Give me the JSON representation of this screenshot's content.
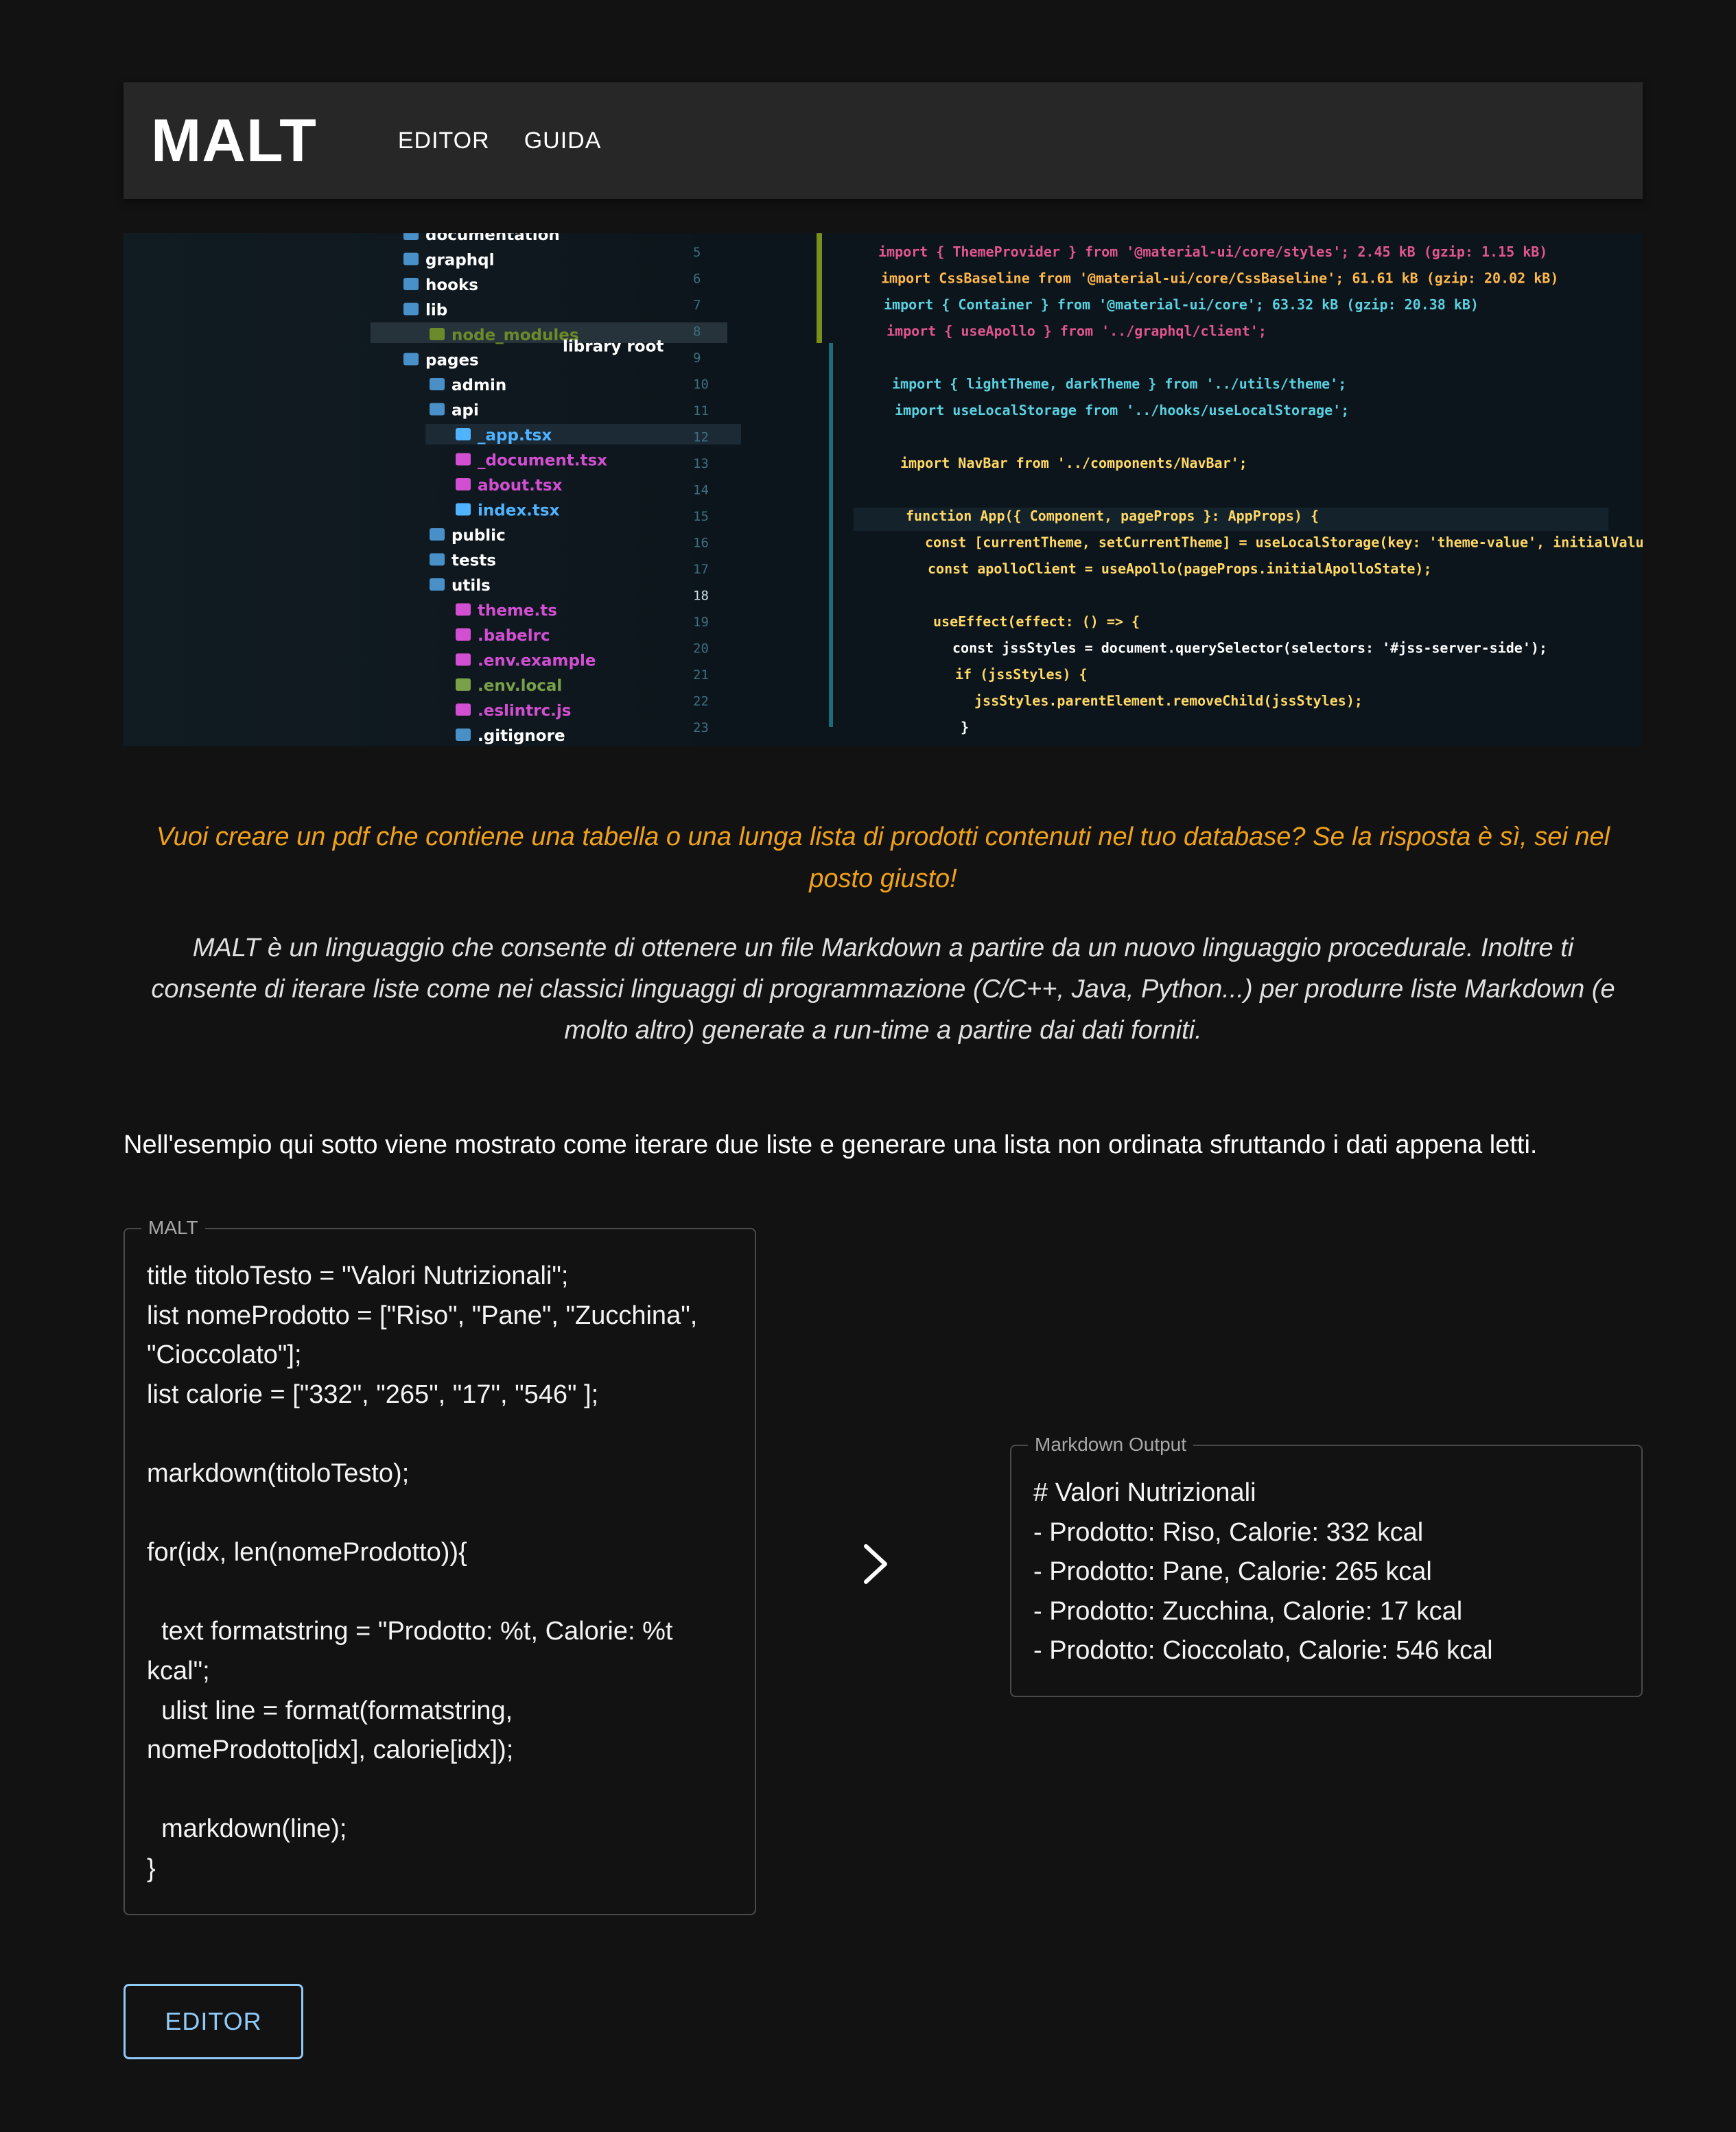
{
  "header": {
    "logo": "MALT",
    "nav": [
      {
        "label": "EDITOR"
      },
      {
        "label": "GUIDA"
      }
    ]
  },
  "hero": {
    "tree": [
      "documentation",
      "graphql",
      "hooks",
      "lib",
      "node_modules",
      "library root",
      "pages",
      "admin",
      "api",
      "_app.tsx",
      "_document.tsx",
      "about.tsx",
      "index.tsx",
      "public",
      "tests",
      "utils",
      "theme.ts",
      ".babelrc",
      ".env.example",
      ".env.local",
      ".eslintrc.js",
      ".gitignore"
    ],
    "line_numbers": [
      "5",
      "6",
      "7",
      "8",
      "9",
      "10",
      "11",
      "12",
      "13",
      "14",
      "15",
      "16",
      "17",
      "18",
      "19",
      "20",
      "21",
      "22",
      "23"
    ],
    "code": [
      "import { ThemeProvider } from '@material-ui/core/styles';  2.45 kB (gzip: 1.15 kB)",
      "import CssBaseline from '@material-ui/core/CssBaseline';  61.61 kB (gzip: 20.02 kB)",
      "import { Container } from '@material-ui/core';  63.32 kB (gzip: 20.38 kB)",
      "import { useApollo } from '../graphql/client';",
      "",
      "import { lightTheme, darkTheme } from '../utils/theme';",
      "import useLocalStorage from '../hooks/useLocalStorage';",
      "",
      "import NavBar from '../components/NavBar';",
      "",
      "function App({ Component, pageProps }: AppProps) {",
      "  const [currentTheme, setCurrentTheme] = useLocalStorage(key: 'theme-value', initialValue: 'light');",
      "  const apolloClient = useApollo(pageProps.initialApolloState);",
      "",
      "  useEffect(effect: () => {",
      "    const jssStyles = document.querySelector(selectors: '#jss-server-side');",
      "    if (jssStyles) {",
      "      jssStyles.parentElement.removeChild(jssStyles);",
      "    }"
    ]
  },
  "lead": "Vuoi creare un pdf che contiene una tabella o una lunga lista di prodotti contenuti nel tuo database? Se la risposta è sì, sei nel posto giusto!",
  "intro": "MALT è un linguaggio che consente di ottenere un file Markdown a partire da un nuovo linguaggio procedurale. Inoltre ti consente di iterare liste come nei classici linguaggi di programmazione (C/C++, Java, Python...) per produrre liste Markdown (e molto altro) generate a run-time a partire dai dati forniti.",
  "example_text": "Nell'esempio qui sotto viene mostrato come iterare due liste e generare una lista non ordinata sfruttando i dati appena letti.",
  "malt_box": {
    "legend": "MALT",
    "code": "title titoloTesto = \"Valori Nutrizionali\";\nlist nomeProdotto = [\"Riso\", \"Pane\", \"Zucchina\", \"Cioccolato\"];\nlist calorie = [\"332\", \"265\", \"17\", \"546\" ];\n\nmarkdown(titoloTesto);\n\nfor(idx, len(nomeProdotto)){\n\n  text formatstring = \"Prodotto: %t, Calorie: %t kcal\";\n  ulist line = format(formatstring, nomeProdotto[idx], calorie[idx]);\n\n  markdown(line);\n}"
  },
  "arrow_icon": "chevron-right-icon",
  "output_box": {
    "legend": "Markdown Output",
    "lines": [
      "# Valori Nutrizionali",
      "- Prodotto: Riso, Calorie: 332 kcal",
      "- Prodotto: Pane, Calorie: 265 kcal",
      "- Prodotto: Zucchina, Calorie: 17 kcal",
      "- Prodotto: Cioccolato, Calorie: 546 kcal"
    ]
  },
  "editor_button": "EDITOR",
  "colors": {
    "background": "#121212",
    "appbar": "#272727",
    "lead": "#f0a21a",
    "button_accent": "#90caf9"
  }
}
